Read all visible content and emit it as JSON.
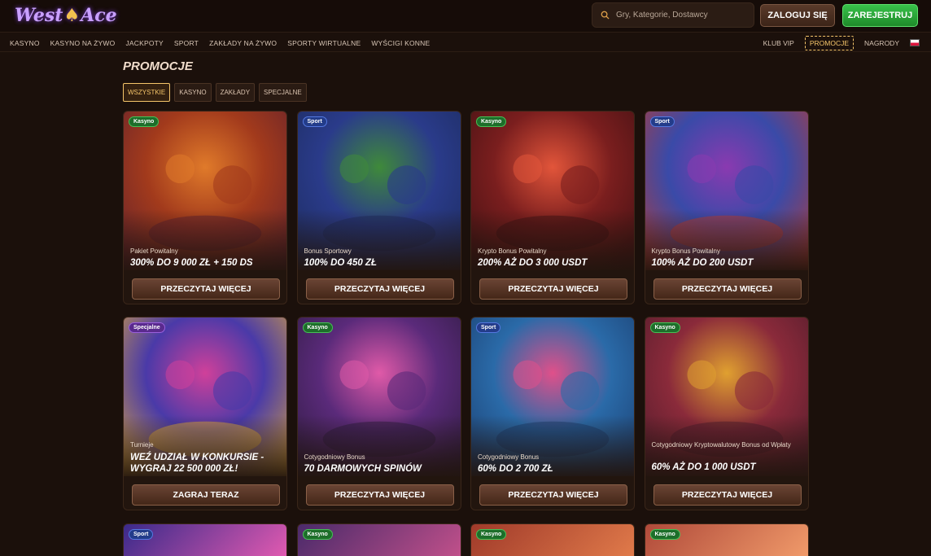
{
  "header": {
    "logo_left": "West",
    "logo_right": "Ace",
    "search_placeholder": "Gry, Kategorie, Dostawcy",
    "login_label": "ZALOGUJ SIĘ",
    "register_label": "ZAREJESTRUJ"
  },
  "nav": {
    "left": [
      "KASYNO",
      "KASYNO NA ŻYWO",
      "JACKPOTY",
      "SPORT",
      "ZAKŁADY NA ŻYWO",
      "SPORTY WIRTUALNE",
      "WYŚCIGI KONNE"
    ],
    "right": [
      "KLUB VIP",
      "PROMOCJE",
      "NAGRODY"
    ],
    "active": "PROMOCJE"
  },
  "page": {
    "title": "PROMOCJE",
    "filters": [
      "WSZYSTKIE",
      "KASYNO",
      "ZAKŁADY",
      "SPECJALNE"
    ],
    "active_filter": "WSZYSTKIE"
  },
  "cards": [
    {
      "badge": "Kasyno",
      "type": "kasyno",
      "subtitle": "Pakiet Powitalny",
      "headline": "300% DO 9 000 ZŁ + 150 DS",
      "cta": "PRZECZYTAJ WIĘCEJ",
      "palette": [
        "#a23a1c",
        "#e07a2a",
        "#5a1e2e"
      ]
    },
    {
      "badge": "Sport",
      "type": "sport",
      "subtitle": "Bonus Sportowy",
      "headline": "100% DO 450 ZŁ",
      "cta": "PRZECZYTAJ WIĘCEJ",
      "palette": [
        "#2a3b8a",
        "#3f8a3a",
        "#1b2a5a"
      ]
    },
    {
      "badge": "Kasyno",
      "type": "kasyno",
      "subtitle": "Krypto Bonus Powitalny",
      "headline": "200% AŻ DO 3 000 USDT",
      "cta": "PRZECZYTAJ WIĘCEJ",
      "palette": [
        "#7a1e1e",
        "#e2553a",
        "#3a0f12"
      ]
    },
    {
      "badge": "Sport",
      "type": "sport",
      "subtitle": "Krypto Bonus Powitalny",
      "headline": "100% AŻ DO 200 USDT",
      "cta": "PRZECZYTAJ WIĘCEJ",
      "palette": [
        "#3a4aa8",
        "#8a3ab0",
        "#c23a2a"
      ]
    },
    {
      "badge": "Specjalne",
      "type": "specjalne",
      "subtitle": "Turnieje",
      "headline": "WEŹ UDZIAŁ W KONKURSIE - WYGRAJ 22 500 000 ZŁ!",
      "cta": "ZAGRAJ TERAZ",
      "palette": [
        "#4a3aa8",
        "#d0409a",
        "#e8b030"
      ]
    },
    {
      "badge": "Kasyno",
      "type": "kasyno",
      "subtitle": "Cotygodniowy Bonus",
      "headline": "70 DARMOWYCH SPINÓW",
      "cta": "PRZECZYTAJ WIĘCEJ",
      "palette": [
        "#5a2a7a",
        "#e05aa8",
        "#2a1a3a"
      ]
    },
    {
      "badge": "Sport",
      "type": "sport",
      "subtitle": "Cotygodniowy Bonus",
      "headline": "60% DO 2 700 ZŁ",
      "cta": "PRZECZYTAJ WIĘCEJ",
      "palette": [
        "#2a6aa8",
        "#e0508a",
        "#1a3a6a"
      ]
    },
    {
      "badge": "Kasyno",
      "type": "kasyno",
      "subtitle": "Cotygodniowy Kryptowalutowy Bonus od Wpłaty",
      "headline": "60% AŻ DO 1 000 USDT",
      "cta": "PRZECZYTAJ WIĘCEJ",
      "palette": [
        "#8a2a3a",
        "#e0a030",
        "#4a1a2a"
      ]
    }
  ],
  "partial_row": [
    {
      "badge": "Sport",
      "type": "sport",
      "palette": [
        "#3a2a8a",
        "#e05ab0"
      ]
    },
    {
      "badge": "Kasyno",
      "type": "kasyno",
      "palette": [
        "#4a2a6a",
        "#c0508a"
      ]
    },
    {
      "badge": "Kasyno",
      "type": "kasyno",
      "palette": [
        "#a03a2a",
        "#e07a4a"
      ]
    },
    {
      "badge": "Kasyno",
      "type": "kasyno",
      "palette": [
        "#b04a3a",
        "#f09a6a"
      ]
    }
  ]
}
